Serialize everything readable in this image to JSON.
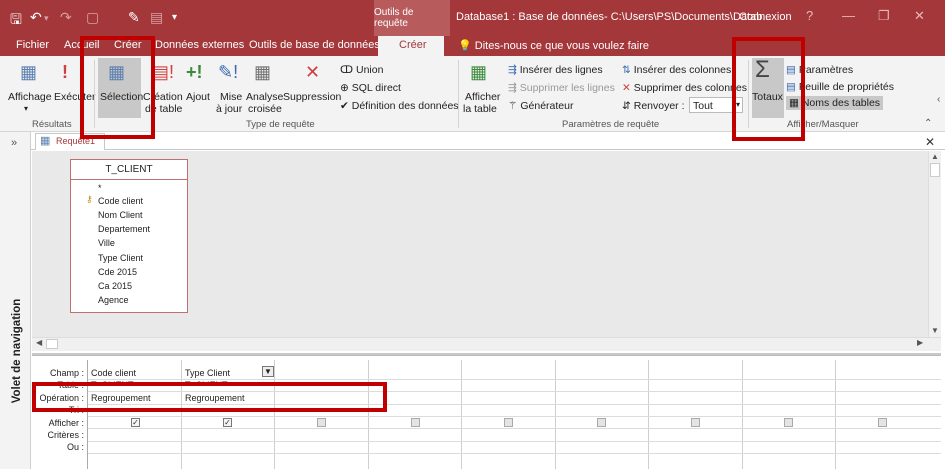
{
  "titlebar": {
    "context_tab": "Outils de requête",
    "doc_title": "Database1 : Base de données- C:\\Users\\PS\\Documents\\Datab...",
    "connexion": "Connexion",
    "help": "?",
    "minimize": "—",
    "restore": "❐",
    "close": "✕"
  },
  "tabs": [
    "Fichier",
    "Accueil",
    "Créer",
    "Données externes",
    "Outils de base de données"
  ],
  "context_tab_label": "Créer",
  "tellme": "Dites-nous ce que vous voulez faire",
  "ribbon": {
    "resultats": {
      "label": "Résultats",
      "affichage": "Affichage",
      "executer": "Exécuter"
    },
    "type_requete": {
      "label": "Type de requête",
      "selection": "Sélection",
      "creation_table_1": "Création",
      "creation_table_2": "de table",
      "ajout": "Ajout",
      "mise_a_jour_1": "Mise",
      "mise_a_jour_2": "à jour",
      "analyse_1": "Analyse",
      "analyse_2": "croisée",
      "suppression": "Suppression",
      "union": "Union",
      "sql_direct": "SQL direct",
      "definition": "Définition des données"
    },
    "parametres": {
      "label": "Paramètres de requête",
      "afficher_1": "Afficher",
      "afficher_2": "la table",
      "inserer_lignes": "Insérer des lignes",
      "supprimer_lignes": "Supprimer les lignes",
      "generateur": "Générateur",
      "inserer_colonnes": "Insérer des colonnes",
      "supprimer_colonnes": "Supprimer des colonnes",
      "renvoyer": "Renvoyer :",
      "renvoyer_value": "Tout"
    },
    "afficher_masquer": {
      "label": "Afficher/Masquer",
      "totaux": "Totaux",
      "parametres": "Paramètres",
      "feuille": "Feuille de propriétés",
      "noms_tables": "Noms des tables"
    }
  },
  "nav": {
    "label": "Volet de navigation"
  },
  "doc_tab": "Requête1",
  "table": {
    "name": "T_CLIENT",
    "fields": [
      "*",
      "Code client",
      "Nom Client",
      "Departement",
      "Ville",
      "Type Client",
      "Cde 2015",
      "Ca 2015",
      "Agence"
    ]
  },
  "grid": {
    "row_labels": [
      "Champ :",
      "Table :",
      "Opération :",
      "Tri :",
      "Afficher :",
      "Critères :",
      "Ou :"
    ],
    "columns": [
      {
        "champ": "Code client",
        "table": "T_CLIENT",
        "operation": "Regroupement",
        "afficher": true
      },
      {
        "champ": "Type Client",
        "table": "T_CLIENT",
        "operation": "Regroupement",
        "afficher": true
      }
    ]
  },
  "colors": {
    "accent": "#a4373a",
    "annotation": "#c00000"
  }
}
